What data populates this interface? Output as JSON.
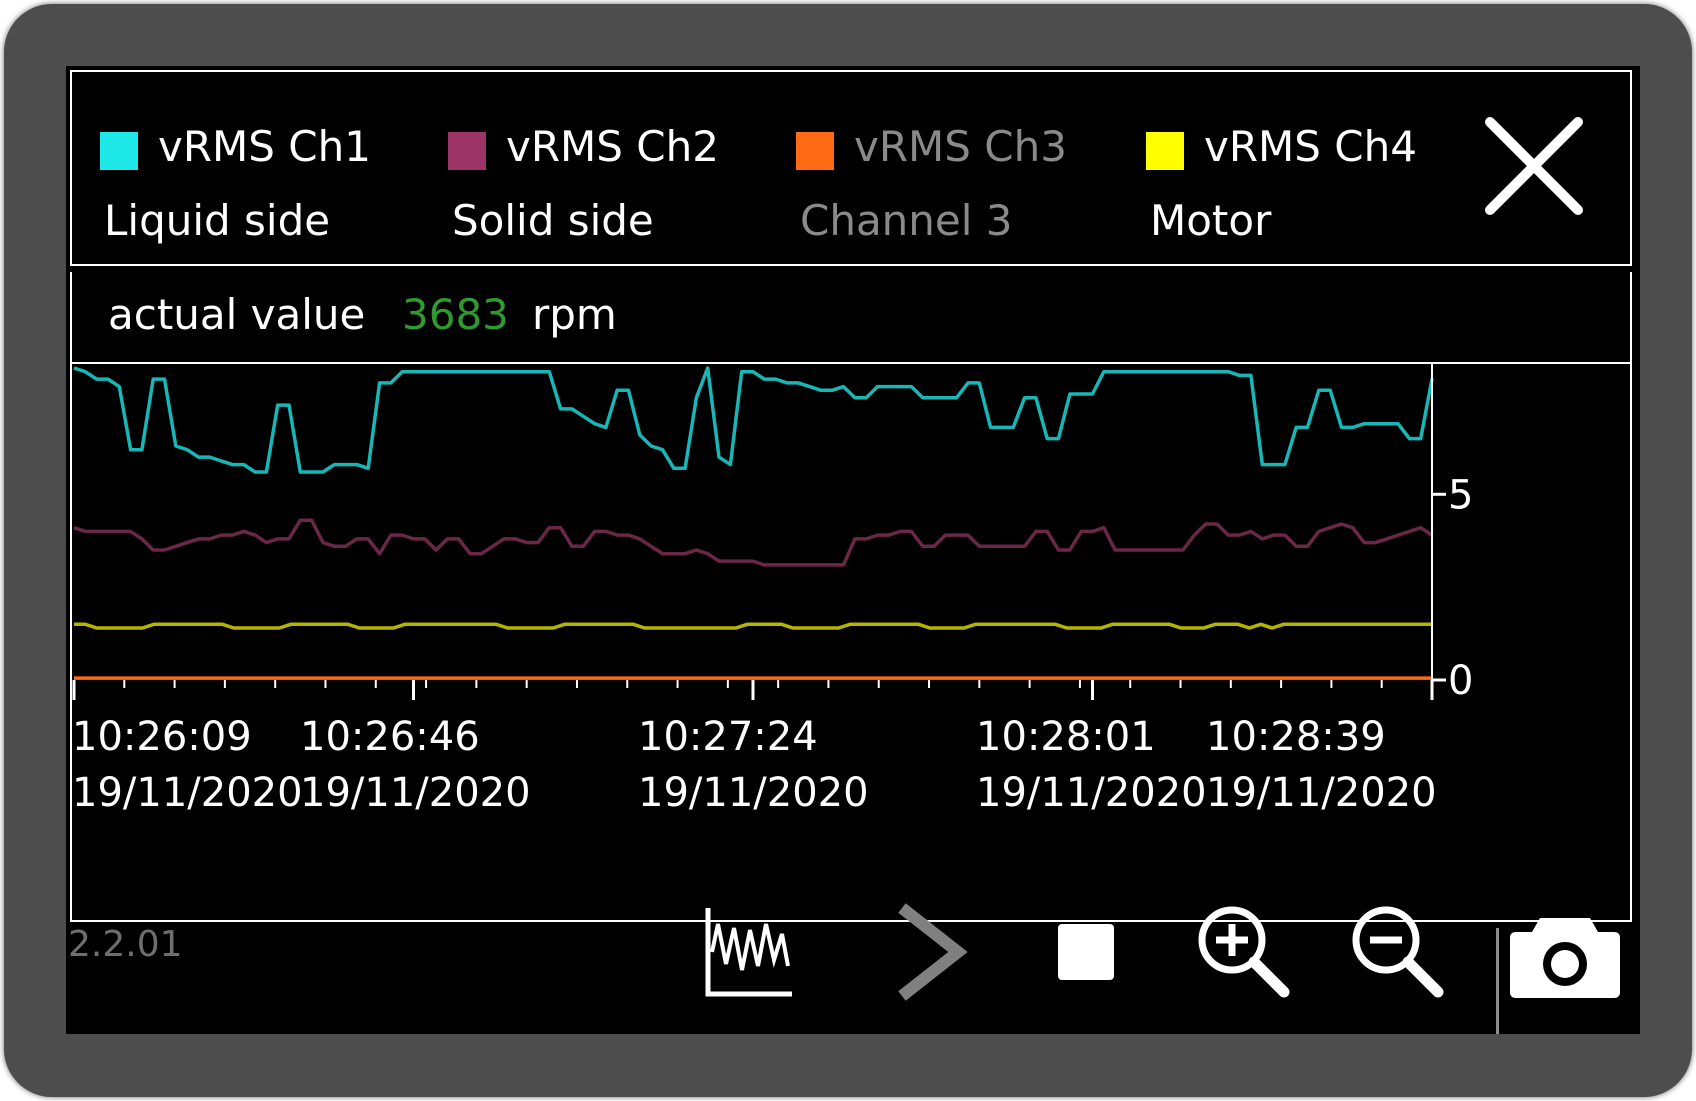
{
  "legend": [
    {
      "name": "vRMS Ch1",
      "sub": "Liquid side",
      "color": "#1ee8e8",
      "active": true
    },
    {
      "name": "vRMS Ch2",
      "sub": "Solid side",
      "color": "#9c3468",
      "active": true
    },
    {
      "name": "vRMS Ch3",
      "sub": "Channel 3",
      "color": "#ff6a14",
      "active": false
    },
    {
      "name": "vRMS Ch4",
      "sub": "Motor",
      "color": "#ffff00",
      "active": true
    }
  ],
  "actual": {
    "label": "actual value",
    "value": "3683",
    "unit": "rpm",
    "value_color": "#2f9a2f"
  },
  "version": "2.2.01",
  "icons": {
    "close": "close-icon",
    "chart": "waveform-chart-icon",
    "play": "chevron-right-icon",
    "stop": "stop-icon",
    "zoom_in": "zoom-in-icon",
    "zoom_out": "zoom-out-icon",
    "camera": "camera-icon"
  },
  "chart_data": {
    "type": "line",
    "ylim": [
      0,
      8.4
    ],
    "y_ticks": [
      "5",
      "0"
    ],
    "x_tick_labels": [
      {
        "time": "10:26:09",
        "date": "19/11/2020"
      },
      {
        "time": "10:26:46",
        "date": "19/11/2020"
      },
      {
        "time": "10:27:24",
        "date": "19/11/2020"
      },
      {
        "time": "10:28:01",
        "date": "19/11/2020"
      },
      {
        "time": "10:28:39",
        "date": "19/11/2020"
      }
    ],
    "series": [
      {
        "name": "vRMS Ch1",
        "color": "#17b7b7",
        "values": [
          8.4,
          8.3,
          8.1,
          8.1,
          7.9,
          6.2,
          6.2,
          8.1,
          8.1,
          6.3,
          6.2,
          6.0,
          6.0,
          5.9,
          5.8,
          5.8,
          5.6,
          5.6,
          7.4,
          7.4,
          5.6,
          5.6,
          5.6,
          5.8,
          5.8,
          5.8,
          5.7,
          8.0,
          8.0,
          8.3,
          8.3,
          8.3,
          8.3,
          8.3,
          8.3,
          8.3,
          8.3,
          8.3,
          8.3,
          8.3,
          8.3,
          8.3,
          8.3,
          7.3,
          7.3,
          7.1,
          6.9,
          6.8,
          7.8,
          7.8,
          6.6,
          6.3,
          6.2,
          5.7,
          5.7,
          7.6,
          8.4,
          6.0,
          5.8,
          8.3,
          8.3,
          8.1,
          8.1,
          8.0,
          8.0,
          7.9,
          7.8,
          7.8,
          7.9,
          7.6,
          7.6,
          7.9,
          7.9,
          7.9,
          7.9,
          7.6,
          7.6,
          7.6,
          7.6,
          8.0,
          8.0,
          6.8,
          6.8,
          6.8,
          7.6,
          7.6,
          6.5,
          6.5,
          7.7,
          7.7,
          7.7,
          8.3,
          8.3,
          8.3,
          8.3,
          8.3,
          8.3,
          8.3,
          8.3,
          8.3,
          8.3,
          8.3,
          8.3,
          8.2,
          8.2,
          5.8,
          5.8,
          5.8,
          6.8,
          6.8,
          7.8,
          7.8,
          6.8,
          6.8,
          6.9,
          6.9,
          6.9,
          6.9,
          6.5,
          6.5,
          8.1
        ]
      },
      {
        "name": "vRMS Ch2",
        "color": "#6b2747",
        "values": [
          4.1,
          4.0,
          4.0,
          4.0,
          4.0,
          4.0,
          3.8,
          3.5,
          3.5,
          3.6,
          3.7,
          3.8,
          3.8,
          3.9,
          3.9,
          4.0,
          3.9,
          3.7,
          3.8,
          3.8,
          4.3,
          4.3,
          3.7,
          3.6,
          3.6,
          3.8,
          3.8,
          3.4,
          3.9,
          3.9,
          3.8,
          3.8,
          3.5,
          3.8,
          3.8,
          3.4,
          3.4,
          3.6,
          3.8,
          3.8,
          3.7,
          3.7,
          4.1,
          4.1,
          3.6,
          3.6,
          4.0,
          4.0,
          3.9,
          3.9,
          3.8,
          3.6,
          3.4,
          3.4,
          3.4,
          3.5,
          3.4,
          3.2,
          3.2,
          3.2,
          3.2,
          3.1,
          3.1,
          3.1,
          3.1,
          3.1,
          3.1,
          3.1,
          3.1,
          3.8,
          3.8,
          3.9,
          3.9,
          4.0,
          4.0,
          3.6,
          3.6,
          3.9,
          3.9,
          3.9,
          3.6,
          3.6,
          3.6,
          3.6,
          3.6,
          4.0,
          4.0,
          3.5,
          3.5,
          4.0,
          4.0,
          4.1,
          3.5,
          3.5,
          3.5,
          3.5,
          3.5,
          3.5,
          3.5,
          3.9,
          4.2,
          4.2,
          3.9,
          3.9,
          4.0,
          3.8,
          3.9,
          3.9,
          3.6,
          3.6,
          4.0,
          4.1,
          4.2,
          4.1,
          3.7,
          3.7,
          3.8,
          3.9,
          4.0,
          4.1,
          3.9
        ]
      },
      {
        "name": "vRMS Ch4",
        "color": "#b5b500",
        "values": [
          1.5,
          1.5,
          1.4,
          1.4,
          1.4,
          1.4,
          1.4,
          1.5,
          1.5,
          1.5,
          1.5,
          1.5,
          1.5,
          1.5,
          1.4,
          1.4,
          1.4,
          1.4,
          1.4,
          1.5,
          1.5,
          1.5,
          1.5,
          1.5,
          1.5,
          1.4,
          1.4,
          1.4,
          1.4,
          1.5,
          1.5,
          1.5,
          1.5,
          1.5,
          1.5,
          1.5,
          1.5,
          1.5,
          1.4,
          1.4,
          1.4,
          1.4,
          1.4,
          1.5,
          1.5,
          1.5,
          1.5,
          1.5,
          1.5,
          1.5,
          1.4,
          1.4,
          1.4,
          1.4,
          1.4,
          1.4,
          1.4,
          1.4,
          1.4,
          1.5,
          1.5,
          1.5,
          1.5,
          1.4,
          1.4,
          1.4,
          1.4,
          1.4,
          1.5,
          1.5,
          1.5,
          1.5,
          1.5,
          1.5,
          1.5,
          1.4,
          1.4,
          1.4,
          1.4,
          1.5,
          1.5,
          1.5,
          1.5,
          1.5,
          1.5,
          1.5,
          1.5,
          1.4,
          1.4,
          1.4,
          1.4,
          1.5,
          1.5,
          1.5,
          1.5,
          1.5,
          1.5,
          1.4,
          1.4,
          1.4,
          1.5,
          1.5,
          1.5,
          1.4,
          1.5,
          1.4,
          1.5,
          1.5,
          1.5,
          1.5,
          1.5,
          1.5,
          1.5,
          1.5,
          1.5,
          1.5,
          1.5,
          1.5,
          1.5,
          1.5
        ]
      },
      {
        "name": "vRMS Ch3",
        "color": "#ff6a14",
        "values": [
          0.05,
          0.05,
          0.05,
          0.05,
          0.05,
          0.05,
          0.05,
          0.05,
          0.05,
          0.05,
          0.05,
          0.05,
          0.05,
          0.05,
          0.05,
          0.05,
          0.05,
          0.05,
          0.05,
          0.05,
          0.05,
          0.05,
          0.05,
          0.05,
          0.05,
          0.05,
          0.05,
          0.05,
          0.05,
          0.05,
          0.05,
          0.05,
          0.05,
          0.05,
          0.05,
          0.05,
          0.05,
          0.05,
          0.05,
          0.05,
          0.05,
          0.05,
          0.05,
          0.05,
          0.05,
          0.05,
          0.05,
          0.05,
          0.05,
          0.05,
          0.05,
          0.05,
          0.05,
          0.05,
          0.05,
          0.05,
          0.05,
          0.05,
          0.05,
          0.05,
          0.05,
          0.05,
          0.05,
          0.05,
          0.05,
          0.05,
          0.05,
          0.05,
          0.05,
          0.05,
          0.05,
          0.05,
          0.05,
          0.05,
          0.05,
          0.05,
          0.05,
          0.05,
          0.05,
          0.05,
          0.05,
          0.05,
          0.05,
          0.05,
          0.05,
          0.05,
          0.05,
          0.05,
          0.05,
          0.05,
          0.05,
          0.05,
          0.05,
          0.05,
          0.05,
          0.05,
          0.05,
          0.05,
          0.05,
          0.05,
          0.05,
          0.05,
          0.05,
          0.05,
          0.05,
          0.05,
          0.05,
          0.05,
          0.05,
          0.05,
          0.05,
          0.05,
          0.05,
          0.05,
          0.05,
          0.05,
          0.05,
          0.05,
          0.05,
          0.05
        ]
      }
    ]
  }
}
